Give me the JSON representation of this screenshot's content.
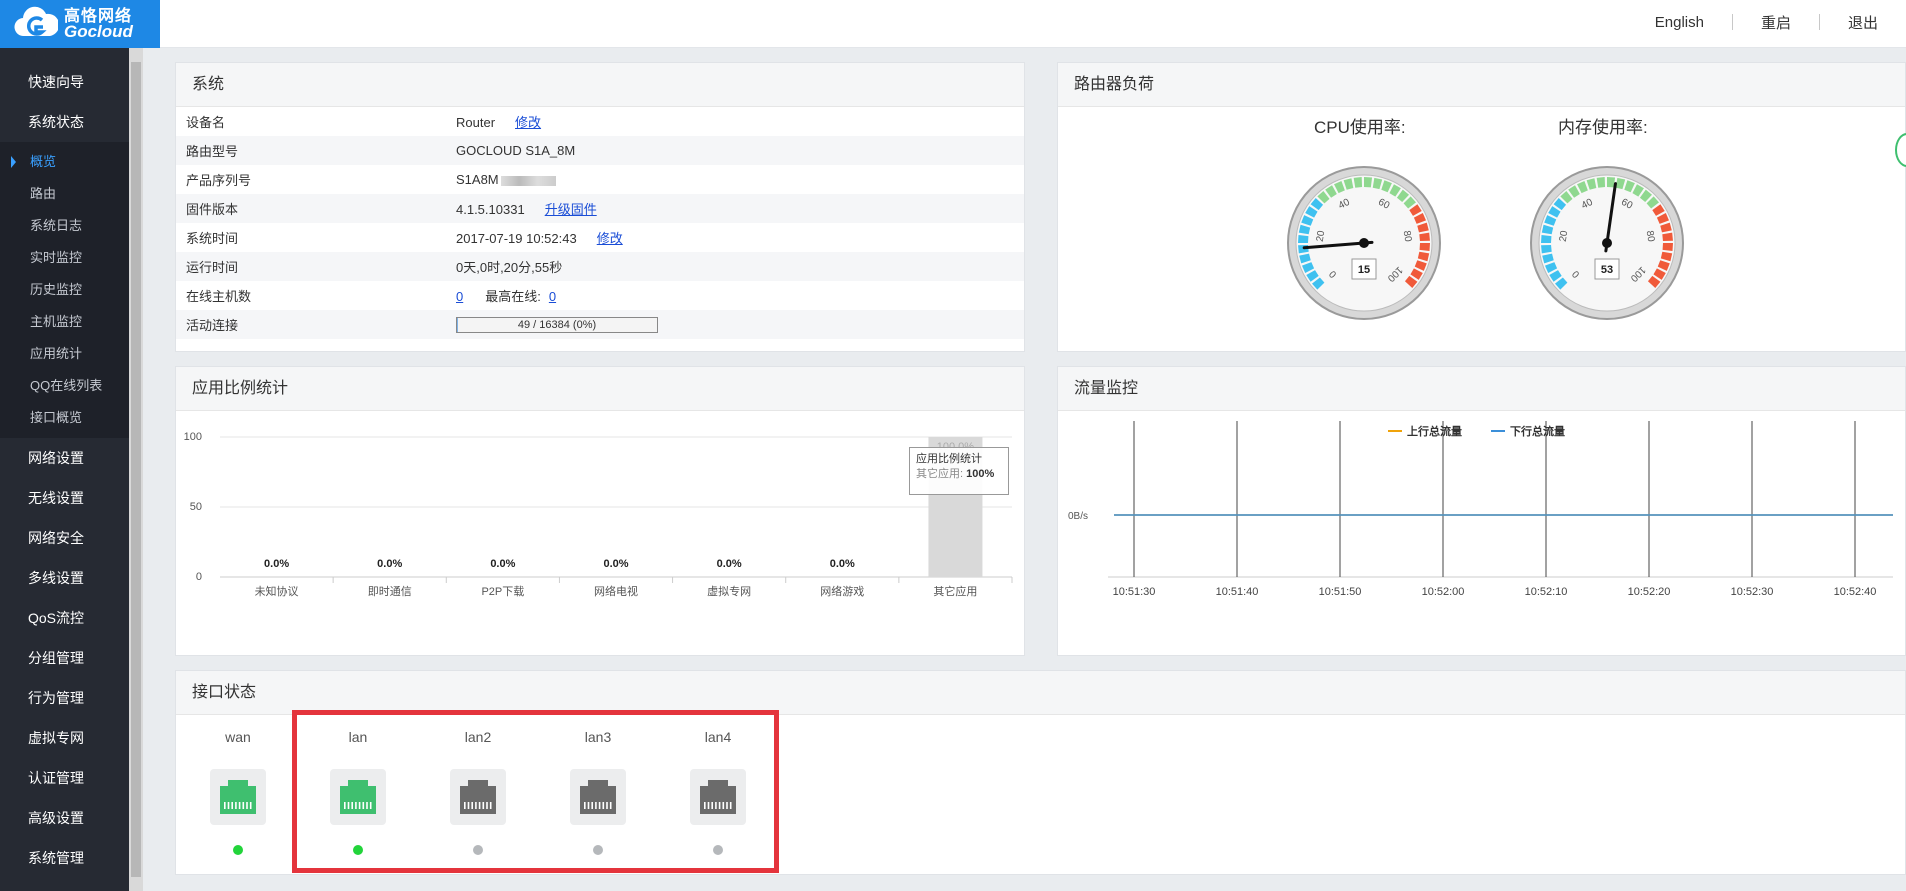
{
  "brand": {
    "name_cn": "高恪网络",
    "name_en": "Gocloud"
  },
  "top_links": [
    "English",
    "重启",
    "退出"
  ],
  "sidebar": {
    "items_top": [
      "快速向导",
      "系统状态"
    ],
    "sub_items": [
      "概览",
      "路由",
      "系统日志",
      "实时监控",
      "历史监控",
      "主机监控",
      "应用统计",
      "QQ在线列表",
      "接口概览"
    ],
    "items_bottom": [
      "网络设置",
      "无线设置",
      "网络安全",
      "多线设置",
      "QoS流控",
      "分组管理",
      "行为管理",
      "虚拟专网",
      "认证管理",
      "高级设置",
      "系统管理"
    ]
  },
  "system": {
    "title": "系统",
    "rows": {
      "device_name": {
        "label": "设备名",
        "value": "Router",
        "link": "修改"
      },
      "model": {
        "label": "路由型号",
        "value": "GOCLOUD S1A_8M"
      },
      "serial": {
        "label": "产品序列号",
        "value": "S1A8M"
      },
      "firmware": {
        "label": "固件版本",
        "value": "4.1.5.10331",
        "link": "升级固件"
      },
      "time": {
        "label": "系统时间",
        "value": "2017-07-19 10:52:43",
        "link": "修改"
      },
      "uptime": {
        "label": "运行时间",
        "value": "0天,0时,20分,55秒"
      },
      "hosts": {
        "label": "在线主机数",
        "value": "0",
        "max_label": "最高在线:",
        "max_value": "0"
      },
      "connections": {
        "label": "活动连接",
        "value": "49 / 16384 (0%)",
        "fraction": 0.003
      }
    }
  },
  "load": {
    "title": "路由器负荷",
    "cpu": {
      "label": "CPU使用率:",
      "value": 15
    },
    "mem": {
      "label": "内存使用率:",
      "value": 53
    },
    "ticks": [
      "0",
      "20",
      "40",
      "60",
      "80",
      "100"
    ]
  },
  "app_stats": {
    "title": "应用比例统计",
    "tooltip": {
      "title": "应用比例统计",
      "label": "其它应用:",
      "value": "100%"
    },
    "chart_data": {
      "type": "bar",
      "categories": [
        "未知协议",
        "即时通信",
        "P2P下载",
        "网络电视",
        "虚拟专网",
        "网络游戏",
        "其它应用"
      ],
      "values": [
        0,
        0,
        0,
        0,
        0,
        0,
        100
      ],
      "data_labels": [
        "0.0%",
        "0.0%",
        "0.0%",
        "0.0%",
        "0.0%",
        "0.0%",
        "100.0%"
      ],
      "yticks": [
        "100",
        "50",
        "0"
      ],
      "ylim": [
        0,
        100
      ],
      "grid": true
    }
  },
  "traffic": {
    "title": "流量监控",
    "chart_data": {
      "type": "line",
      "x": [
        "10:51:30",
        "10:51:40",
        "10:51:50",
        "10:52:00",
        "10:52:10",
        "10:52:20",
        "10:52:30",
        "10:52:40"
      ],
      "ytick": "0B/s",
      "series": [
        {
          "name": "上行总流量",
          "color": "#f0a30a",
          "values": [
            0,
            0,
            0,
            0,
            0,
            0,
            0,
            0
          ]
        },
        {
          "name": "下行总流量",
          "color": "#3b8fd9",
          "values": [
            0,
            0,
            0,
            0,
            0,
            0,
            0,
            0
          ]
        }
      ],
      "legend": "top-center"
    }
  },
  "interfaces": {
    "title": "接口状态",
    "ports": [
      {
        "name": "wan",
        "up": true
      },
      {
        "name": "lan",
        "up": true
      },
      {
        "name": "lan2",
        "up": false
      },
      {
        "name": "lan3",
        "up": false
      },
      {
        "name": "lan4",
        "up": false
      }
    ]
  },
  "colors": {
    "accent": "#1e88e5",
    "sidebar_bg": "#262a33",
    "port_up": "#3fbf6f",
    "port_down": "#6b6b6b",
    "highlight": "#e4343c"
  }
}
